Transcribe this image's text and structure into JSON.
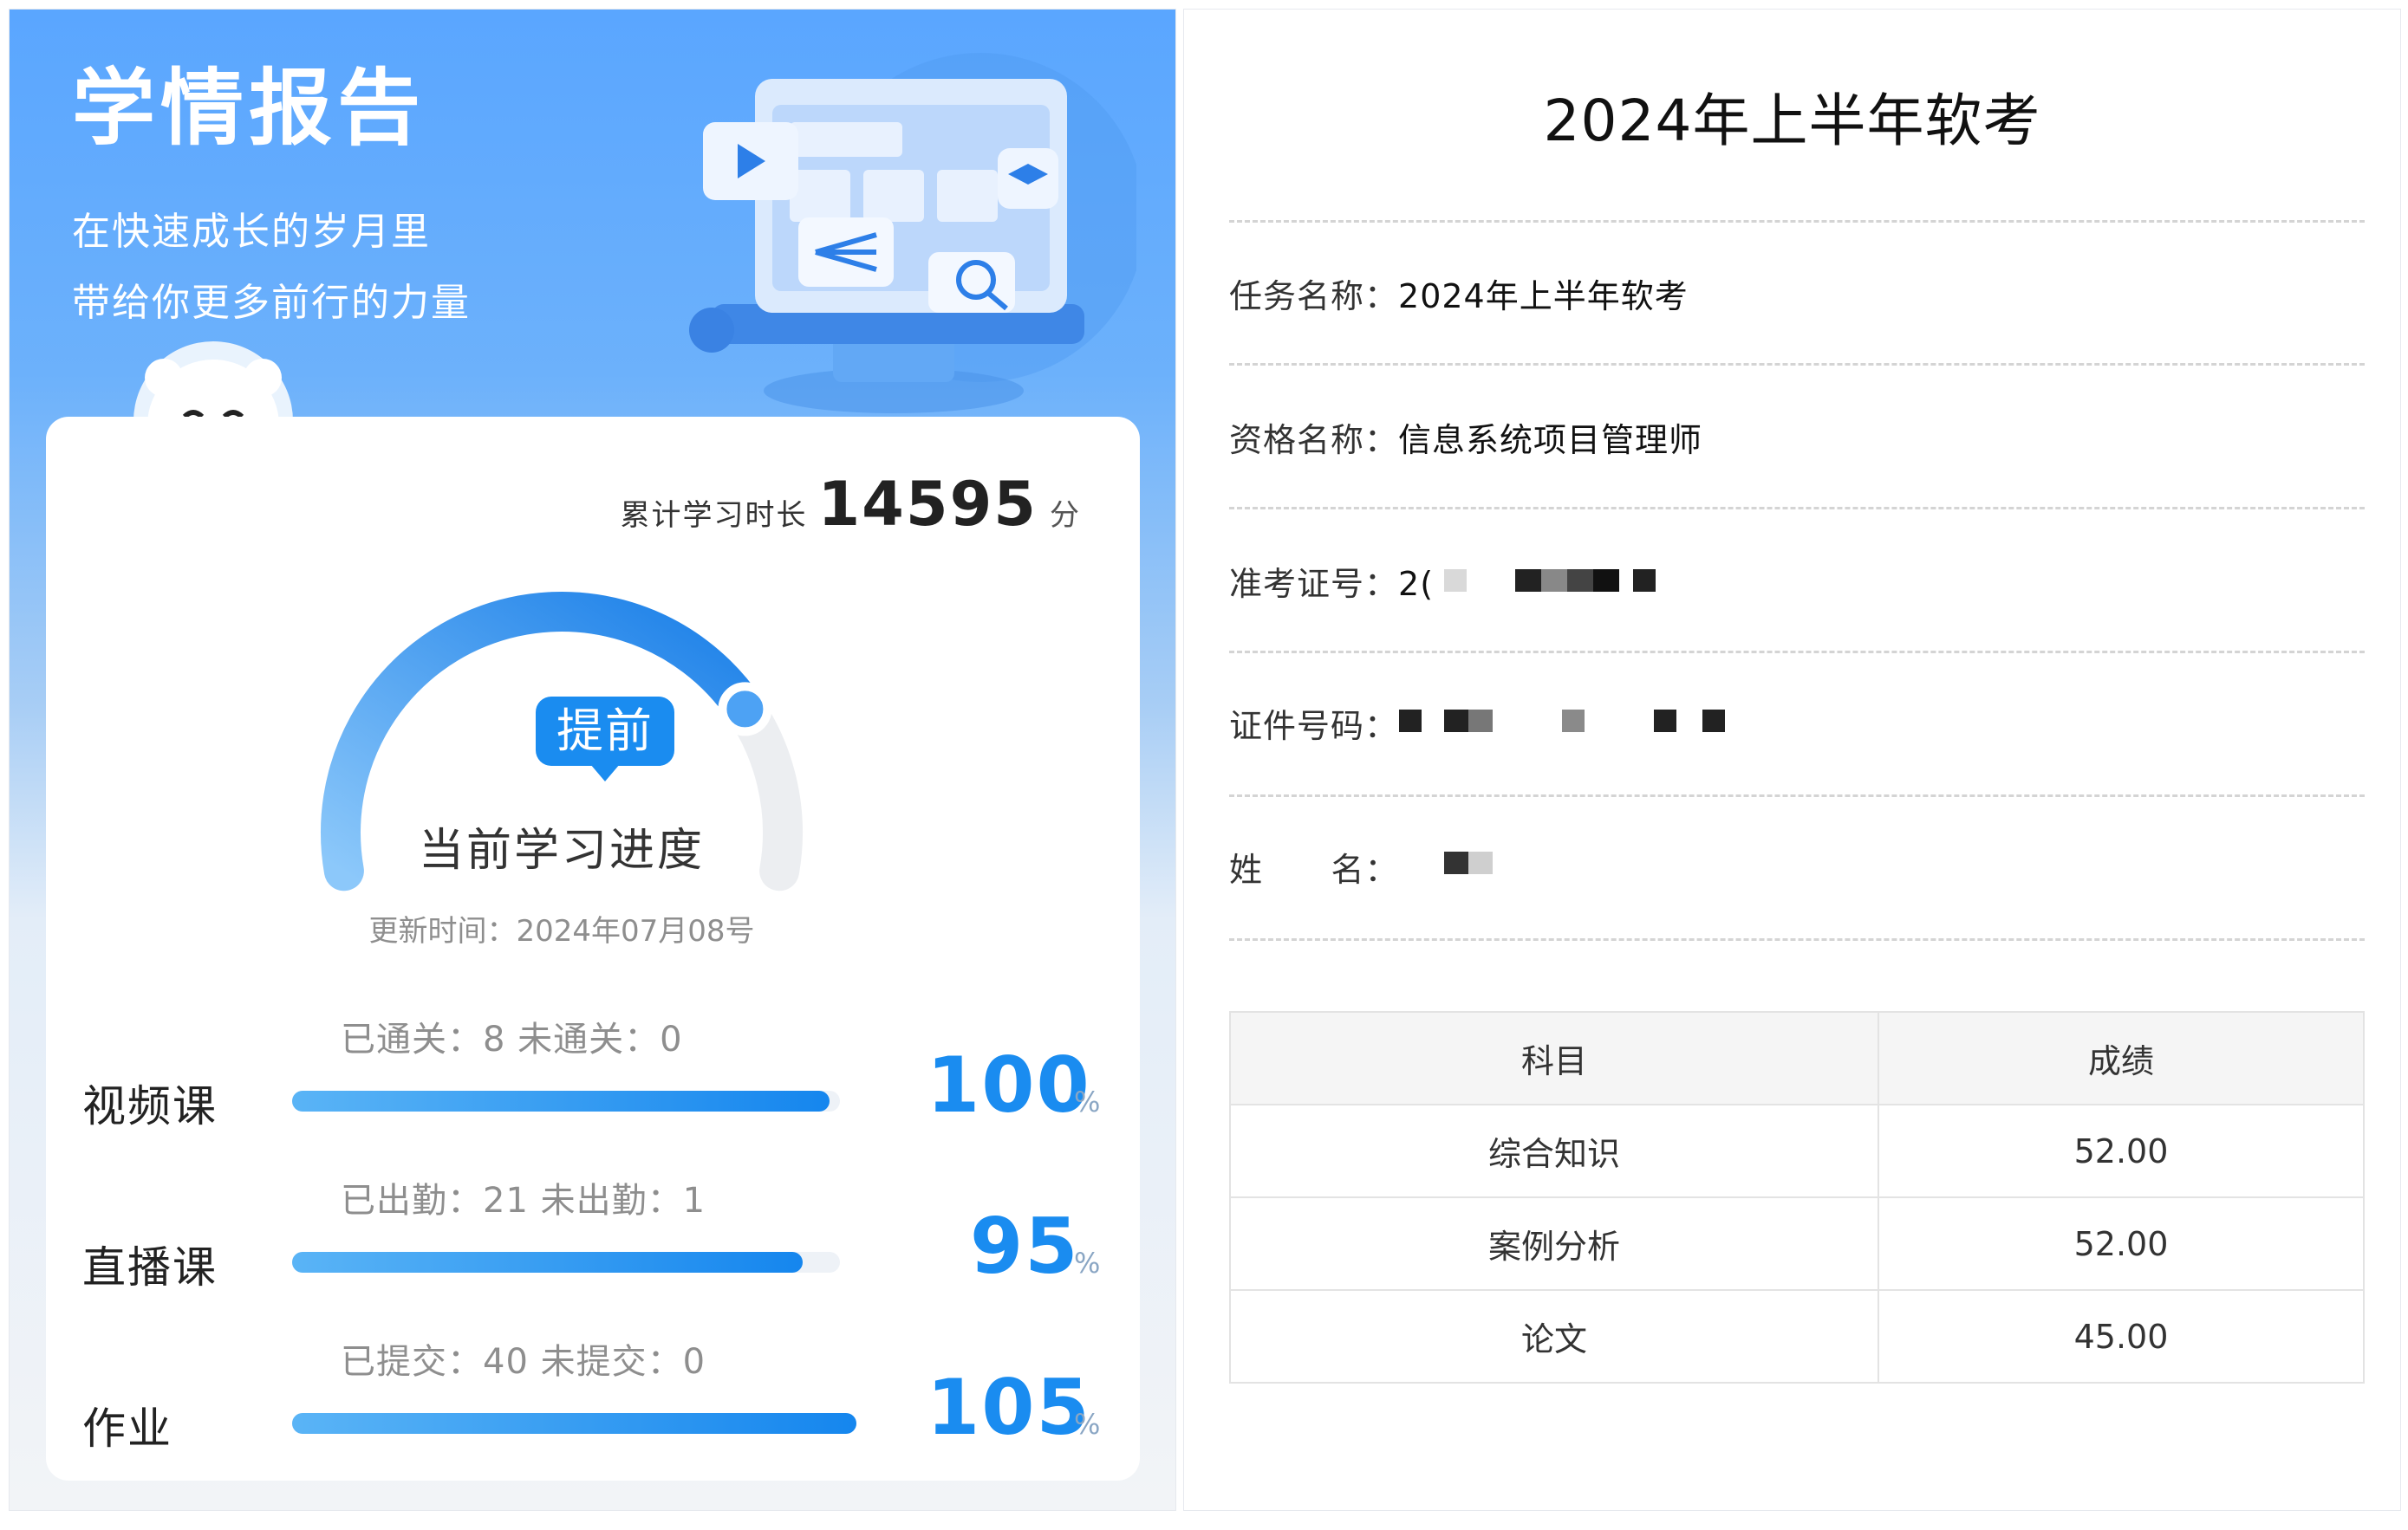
{
  "left": {
    "title": "学情报告",
    "slogan_line1": "在快速成长的岁月里",
    "slogan_line2": "带给你更多前行的力量",
    "study_time_label": "累计学习时长",
    "study_time_value": "14595",
    "study_time_unit": "分",
    "progress_badge": "提前",
    "progress_label": "当前学习进度",
    "progress_fraction": 0.78,
    "update_time": "更新时间：2024年07月08号",
    "accent_color": "#1a8cf0",
    "rows": [
      {
        "name": "视频课",
        "stats": "已通关：8   未通关：0",
        "percent": "100",
        "fraction": 1.0,
        "sign": "%"
      },
      {
        "name": "直播课",
        "stats": "已出勤：21   未出勤：1",
        "percent": "95",
        "fraction": 0.95,
        "sign": "%"
      },
      {
        "name": "作业",
        "stats": "已提交：40   未提交：0",
        "percent": "105",
        "fraction": 1.05,
        "sign": "%"
      }
    ]
  },
  "right": {
    "title": "2024年上半年软考",
    "task_label": "任务名称：",
    "task_value": "2024年上半年软考",
    "qual_label": "资格名称：",
    "qual_value": "信息系统项目管理师",
    "ticket_label": "准考证号：",
    "ticket_value_visible": "2(",
    "id_label": "证件号码：",
    "name_label": "姓      名：",
    "table": {
      "headers": [
        "科目",
        "成绩"
      ],
      "rows": [
        [
          "综合知识",
          "52.00"
        ],
        [
          "案例分析",
          "52.00"
        ],
        [
          "论文",
          "45.00"
        ]
      ]
    }
  }
}
